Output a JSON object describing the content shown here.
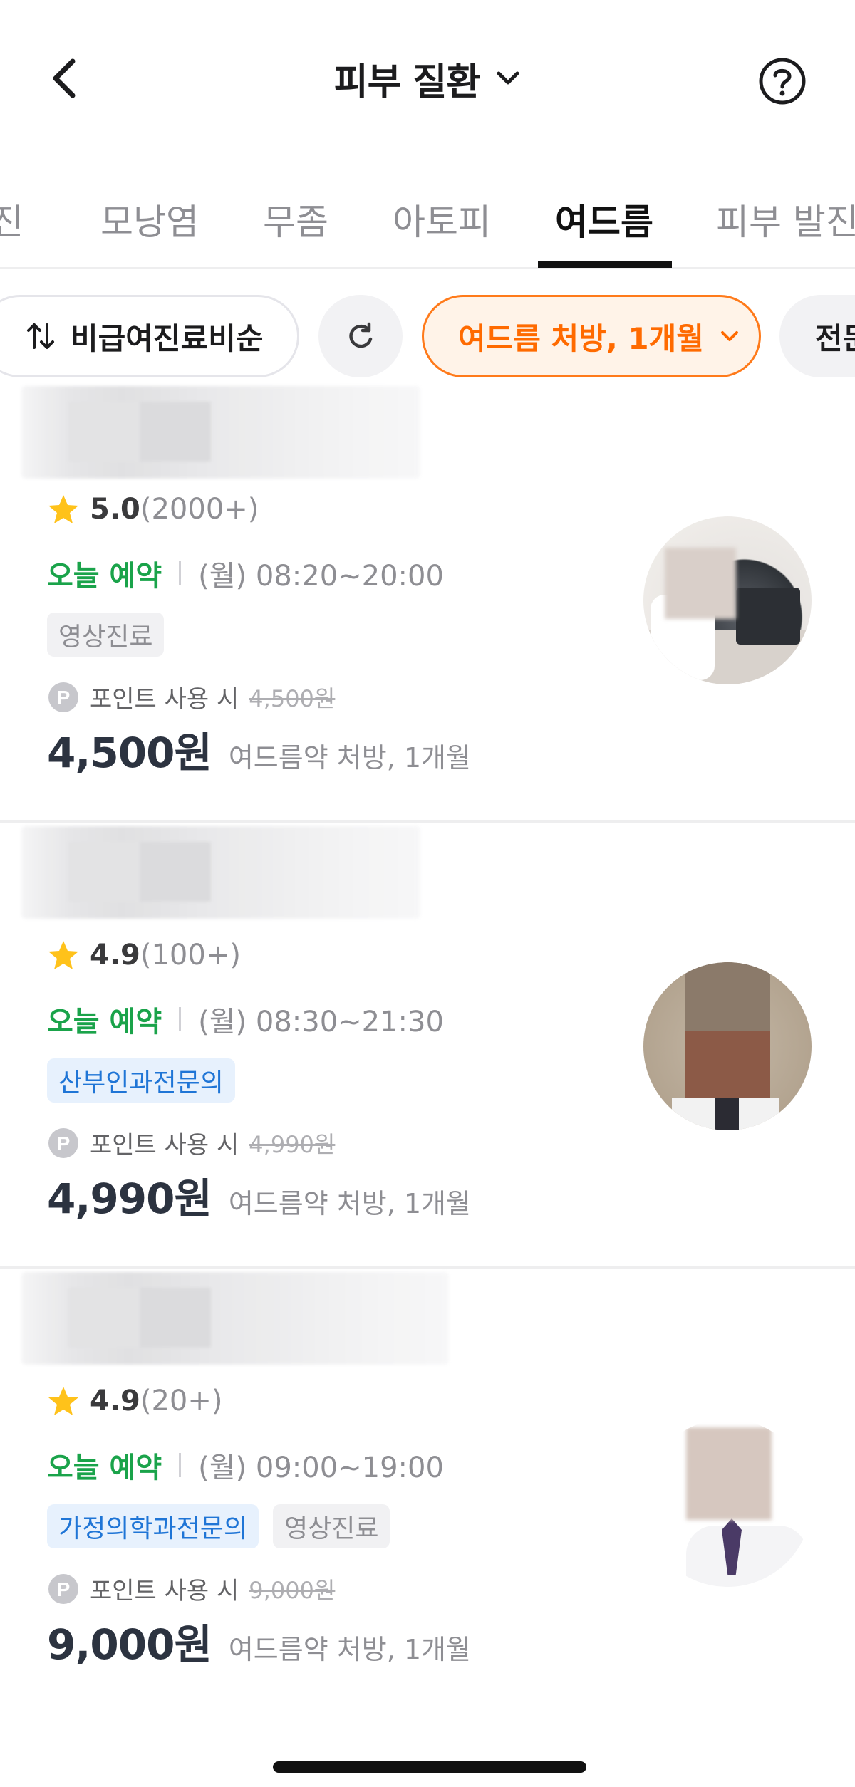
{
  "header": {
    "title": "피부 질환",
    "back_icon": "chevron-left-icon",
    "help_icon": "help-circle-icon"
  },
  "tabs": [
    {
      "label": "진",
      "active": false
    },
    {
      "label": "모낭염",
      "active": false
    },
    {
      "label": "무좀",
      "active": false
    },
    {
      "label": "아토피",
      "active": false
    },
    {
      "label": "여드름",
      "active": true
    },
    {
      "label": "피부 발진",
      "active": false
    }
  ],
  "filters": {
    "sort_label": "비급여진료비순",
    "condition_label": "여드름 처방, 1개월",
    "more_label": "전문"
  },
  "clinics": [
    {
      "rating": "5.0",
      "reviews": "(2000+)",
      "today_label": "오늘 예약",
      "hours": "(월) 08:20~20:00",
      "tags": [
        {
          "text": "영상진료",
          "style": "gray"
        }
      ],
      "points_label": "포인트 사용 시",
      "original_price": "4,500원",
      "price": "4,500원",
      "price_desc": "여드름약 처방, 1개월"
    },
    {
      "rating": "4.9",
      "reviews": "(100+)",
      "today_label": "오늘 예약",
      "hours": "(월) 08:30~21:30",
      "tags": [
        {
          "text": "산부인과전문의",
          "style": "blue"
        }
      ],
      "points_label": "포인트 사용 시",
      "original_price": "4,990원",
      "price": "4,990원",
      "price_desc": "여드름약 처방, 1개월"
    },
    {
      "rating": "4.9",
      "reviews": "(20+)",
      "today_label": "오늘 예약",
      "hours": "(월) 09:00~19:00",
      "tags": [
        {
          "text": "가정의학과전문의",
          "style": "blue"
        },
        {
          "text": "영상진료",
          "style": "gray"
        }
      ],
      "points_label": "포인트 사용 시",
      "original_price": "9,000원",
      "price": "9,000원",
      "price_desc": "여드름약 처방, 1개월"
    }
  ],
  "colors": {
    "accent_orange": "#ff6a00",
    "available_green": "#1aa34a",
    "tag_blue": "#1f75d6",
    "star_yellow": "#ffc21a"
  }
}
